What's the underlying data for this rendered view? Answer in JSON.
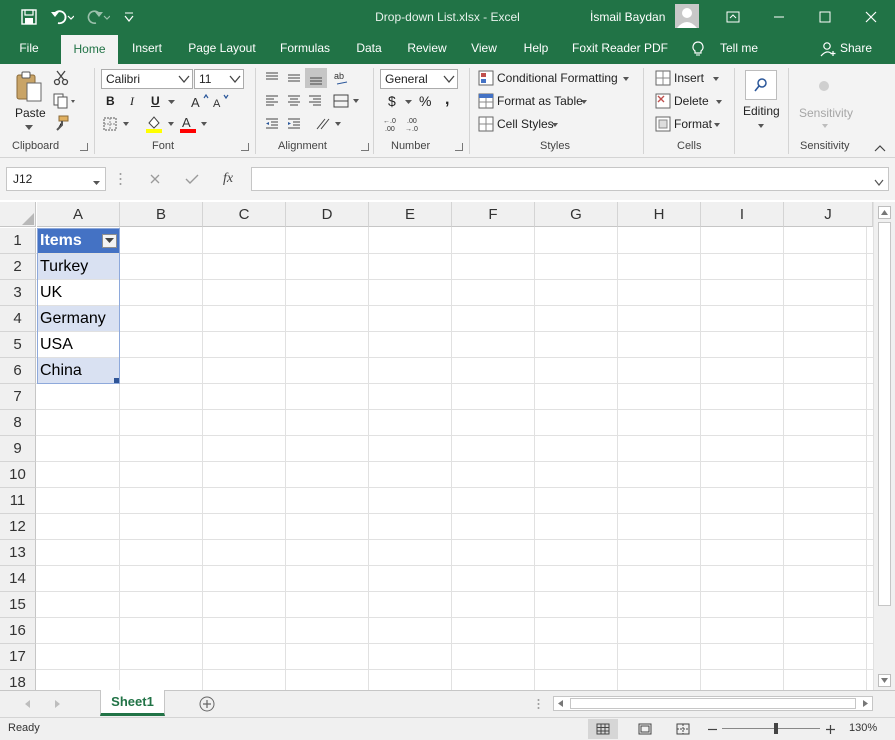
{
  "titlebar": {
    "title": "Drop-down List.xlsx  -  Excel",
    "user": "İsmail Baydan"
  },
  "tabs": [
    "File",
    "Home",
    "Insert",
    "Page Layout",
    "Formulas",
    "Data",
    "Review",
    "View",
    "Help",
    "Foxit Reader PDF"
  ],
  "active_tab": "Home",
  "tell_me": "Tell me",
  "share": "Share",
  "ribbon": {
    "clipboard": {
      "label": "Clipboard",
      "paste": "Paste"
    },
    "font": {
      "label": "Font",
      "name": "Calibri",
      "size": "11",
      "bold": "B",
      "italic": "I",
      "underline": "U",
      "fill_color": "#ffff00",
      "font_color": "#ff0000"
    },
    "alignment": {
      "label": "Alignment"
    },
    "number": {
      "label": "Number",
      "format": "General",
      "currency": "$",
      "percent": "%",
      "comma": ","
    },
    "styles": {
      "label": "Styles",
      "conditional": "Conditional Formatting",
      "table": "Format as Table",
      "cell_styles": "Cell Styles"
    },
    "cells": {
      "label": "Cells",
      "insert": "Insert",
      "delete": "Delete",
      "format": "Format"
    },
    "editing": {
      "label": "Editing"
    },
    "sensitivity": {
      "label": "Sensitivity",
      "button": "Sensitivity"
    }
  },
  "formula_bar": {
    "name_box": "J12",
    "formula": "",
    "fx": "fx"
  },
  "sheet": {
    "columns": [
      "A",
      "B",
      "C",
      "D",
      "E",
      "F",
      "G",
      "H",
      "I",
      "J"
    ],
    "rows": [
      "1",
      "2",
      "3",
      "4",
      "5",
      "6",
      "7",
      "8",
      "9",
      "10",
      "11",
      "12",
      "13",
      "14",
      "15",
      "16",
      "17",
      "18"
    ],
    "table_header": "Items",
    "items": [
      "Turkey",
      "UK",
      "Germany",
      "USA",
      "China"
    ],
    "header_color": "#4472c4",
    "band_color": "#d9e1f2"
  },
  "sheet_tabs": [
    "Sheet1"
  ],
  "status": {
    "ready": "Ready",
    "zoom": "130%"
  },
  "colors": {
    "accent": "#217346"
  }
}
